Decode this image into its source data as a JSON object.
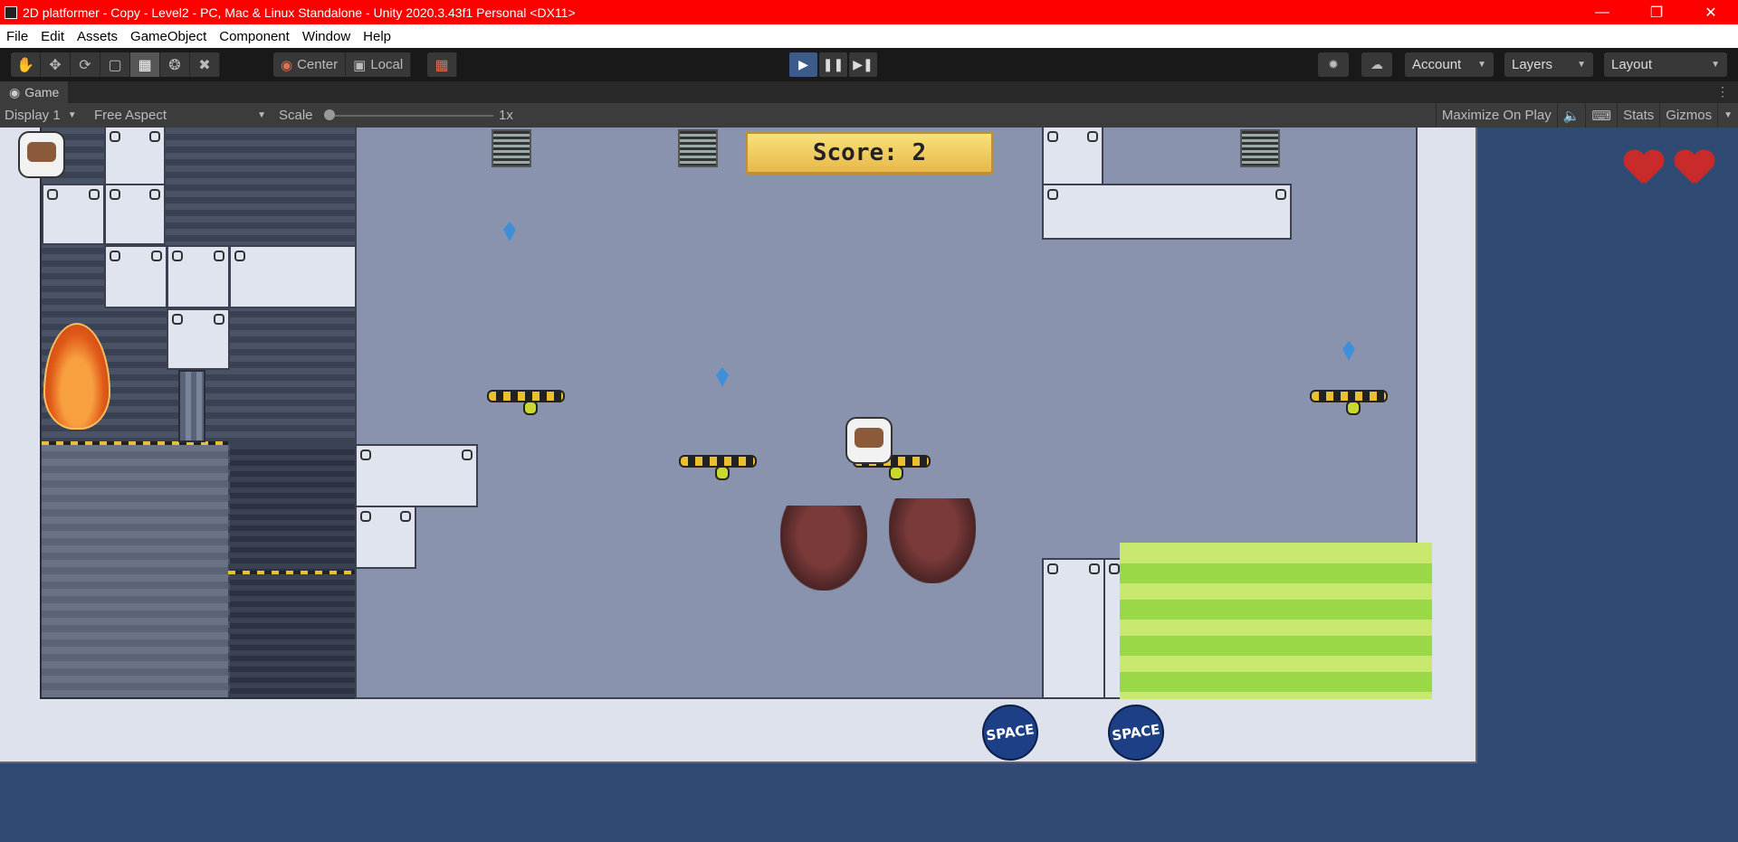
{
  "window": {
    "title": "2D platformer - Copy - Level2 - PC, Mac & Linux Standalone - Unity 2020.3.43f1 Personal <DX11>"
  },
  "menu": [
    "File",
    "Edit",
    "Assets",
    "GameObject",
    "Component",
    "Window",
    "Help"
  ],
  "toolbar": {
    "pivot_label": "Center",
    "space_label": "Local",
    "account_label": "Account",
    "layers_label": "Layers",
    "layout_label": "Layout"
  },
  "tab": {
    "label": "Game"
  },
  "gamebar": {
    "display_label": "Display 1",
    "aspect_label": "Free Aspect",
    "scale_label": "Scale",
    "scale_value": "1x",
    "maximize_label": "Maximize On Play",
    "stats_label": "Stats",
    "gizmos_label": "Gizmos"
  },
  "game": {
    "score_text": "Score: 2",
    "lives": 2,
    "logo_text": "SPACE"
  }
}
